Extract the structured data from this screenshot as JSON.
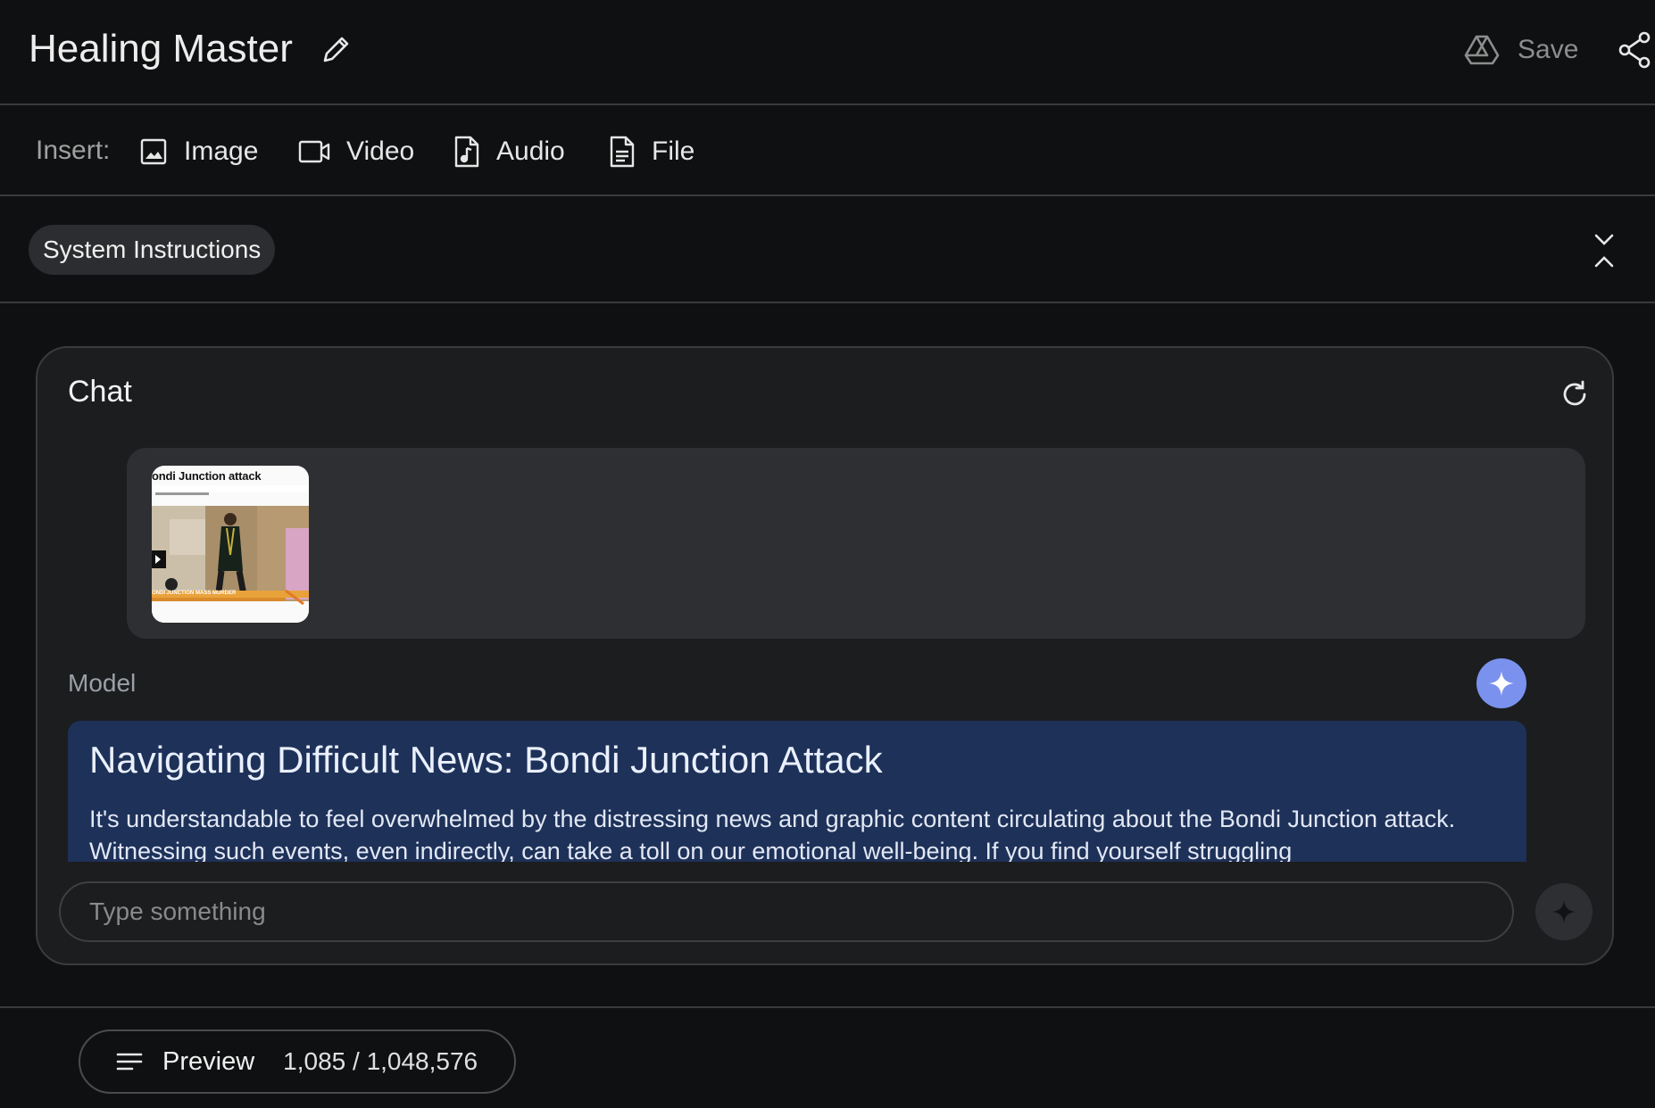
{
  "header": {
    "title": "Healing Master",
    "save_label": "Save",
    "icons": {
      "edit": "pencil-icon",
      "save": "drive-icon",
      "share": "share-icon"
    }
  },
  "insert_bar": {
    "label": "Insert:",
    "items": [
      {
        "label": "Image",
        "icon": "image-icon"
      },
      {
        "label": "Video",
        "icon": "video-icon"
      },
      {
        "label": "Audio",
        "icon": "audio-file-icon"
      },
      {
        "label": "File",
        "icon": "file-icon"
      }
    ]
  },
  "system_instructions": {
    "label": "System Instructions",
    "toggle_icon": "collapse-expand-icon"
  },
  "chat": {
    "title": "Chat",
    "refresh_icon": "refresh-icon",
    "user_attachment": {
      "thumbnail_title": "ondi Junction attack",
      "thumbnail_banner": "ONDI JUNCTION MASS MURDER",
      "type": "video"
    },
    "model": {
      "label": "Model",
      "heading": "Navigating Difficult News: Bondi Junction Attack",
      "body": "It's understandable to feel overwhelmed by the distressing news and graphic content circulating about the Bondi Junction attack. Witnessing such events, even indirectly, can take a toll on our emotional well-being. If you find yourself struggling"
    },
    "input": {
      "value": "",
      "placeholder": "Type something"
    }
  },
  "footer": {
    "preview_label": "Preview",
    "token_count": "1,085 / 1,048,576"
  },
  "colors": {
    "background": "#0f1011",
    "card": "#1c1d1f",
    "model_response_bg": "#1e3158",
    "model_avatar": "#7a92ee",
    "divider": "#3a3b3d"
  }
}
